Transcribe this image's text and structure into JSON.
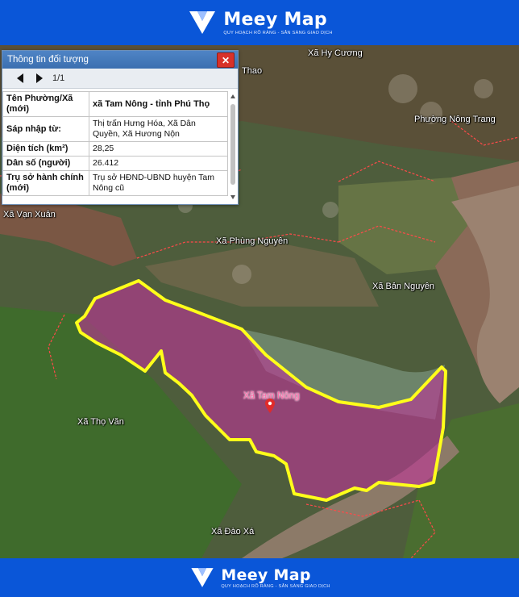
{
  "brand": {
    "name": "Meey Map",
    "tagline": "QUY HOẠCH RÕ RÀNG - SẴN SÀNG GIAO DỊCH",
    "colors": {
      "banner": "#0a56d8",
      "text": "#ffffff"
    }
  },
  "map": {
    "labels": {
      "thao": "Thao",
      "hy_cuong": "Xã Hy Cương",
      "nong_trang": "Phường Nông Trang",
      "van_xuan": "Xã Vạn Xuân",
      "phung_nguyen": "Xã Phùng Nguyên",
      "ban_nguyen": "Xã Bản Nguyên",
      "tam_nong": "Xã Tam Nông",
      "tho_van": "Xã Thọ Văn",
      "dao_xa": "Xã Đào Xá"
    },
    "highlight": {
      "fill": "#c0339a",
      "border": "#ffff1a",
      "border_style": "solid"
    },
    "boundary_color": "#ff4a4a",
    "pin_icon": "map-pin-icon"
  },
  "info_panel": {
    "title": "Thông tin đối tượng",
    "pager": "1/1",
    "close_icon": "close-icon",
    "prev_icon": "triangle-left-icon",
    "next_icon": "triangle-right-icon",
    "rows": [
      {
        "label": "Tên Phường/Xã (mới)",
        "value": "xã Tam Nông - tỉnh Phú Thọ"
      },
      {
        "label": "Sáp nhập từ:",
        "value": "Thị trấn Hưng Hóa, Xã Dân Quyền, Xã Hương Nộn"
      },
      {
        "label": "Diện tích (km²)",
        "value": "28,25"
      },
      {
        "label": "Dân số (người)",
        "value": "26.412"
      },
      {
        "label": "Trụ sở hành chính (mới)",
        "value": "Trụ sở HĐND-UBND huyện Tam Nông cũ"
      }
    ]
  }
}
